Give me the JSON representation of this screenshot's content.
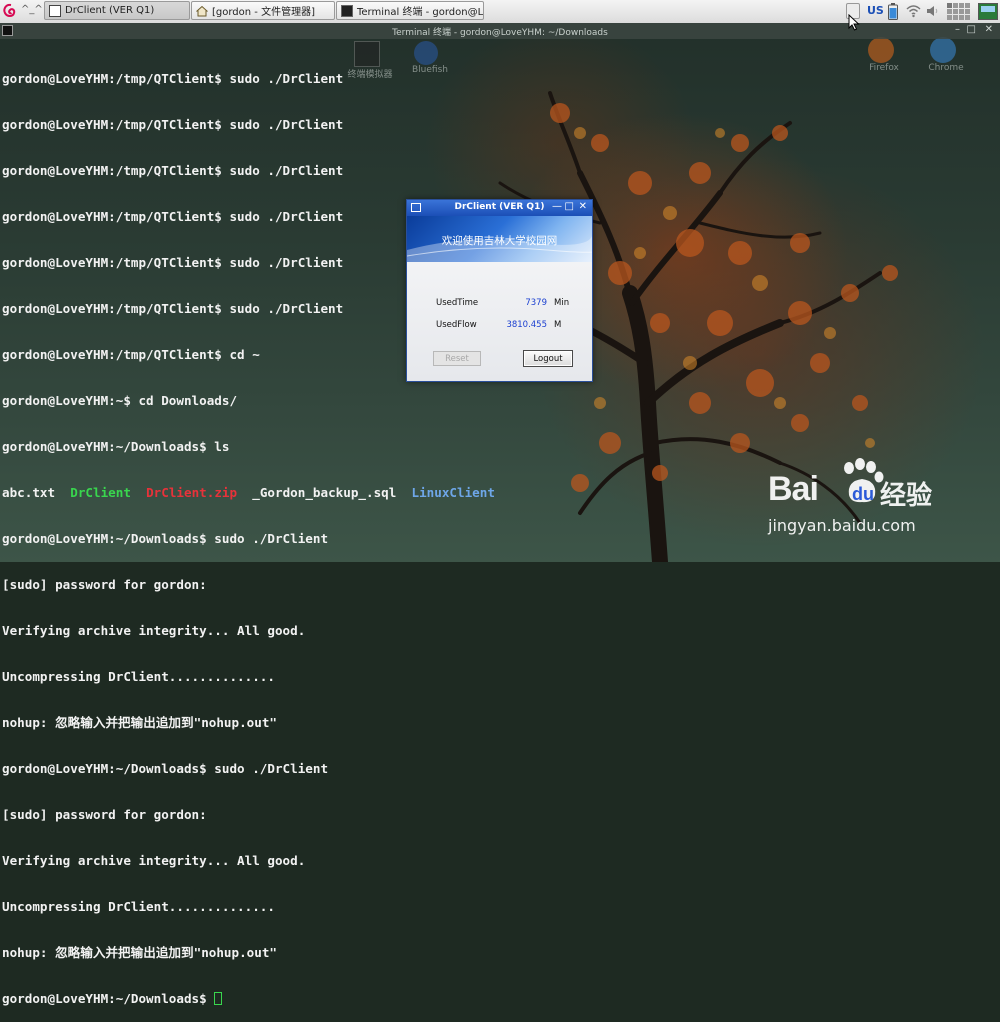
{
  "taskbar": {
    "hat_text": "^_^",
    "tasks": [
      {
        "label": "DrClient (VER Q1)",
        "active": true
      },
      {
        "label": "[gordon - 文件管理器]",
        "active": false
      },
      {
        "label": "Terminal 终端 - gordon@Lo...",
        "active": false
      }
    ],
    "tray": {
      "keyboard_layout": "US"
    }
  },
  "terminal": {
    "window_title": "Terminal 终端 - gordon@LoveYHM: ~/Downloads",
    "lines": [
      "gordon@LoveYHM:/tmp/QTClient$ sudo ./DrClient",
      "gordon@LoveYHM:/tmp/QTClient$ sudo ./DrClient",
      "gordon@LoveYHM:/tmp/QTClient$ sudo ./DrClient",
      "gordon@LoveYHM:/tmp/QTClient$ sudo ./DrClient",
      "gordon@LoveYHM:/tmp/QTClient$ sudo ./DrClient",
      "gordon@LoveYHM:/tmp/QTClient$ sudo ./DrClient",
      "gordon@LoveYHM:/tmp/QTClient$ cd ~",
      "gordon@LoveYHM:~$ cd Downloads/",
      "gordon@LoveYHM:~/Downloads$ ls"
    ],
    "ls_output": {
      "f1": "abc.txt",
      "f2": "DrClient",
      "f3": "DrClient.zip",
      "f4": "_Gordon_backup_.sql",
      "f5": "LinuxClient"
    },
    "lines2": [
      "gordon@LoveYHM:~/Downloads$ sudo ./DrClient",
      "[sudo] password for gordon:",
      "Verifying archive integrity... All good.",
      "Uncompressing DrClient..............",
      "nohup: 忽略输入并把输出追加到\"nohup.out\"",
      "gordon@LoveYHM:~/Downloads$ sudo ./DrClient",
      "[sudo] password for gordon:",
      "Verifying archive integrity... All good.",
      "Uncompressing DrClient..............",
      "nohup: 忽略输入并把输出追加到\"nohup.out\""
    ],
    "prompt": "gordon@LoveYHM:~/Downloads$ "
  },
  "desktop_icons": [
    {
      "label": "终端模拟器"
    },
    {
      "label": "Bluefish"
    },
    {
      "label": "Firefox"
    },
    {
      "label": "Chrome"
    }
  ],
  "dialog": {
    "title": "DrClient (VER Q1)",
    "banner_text": "欢迎使用吉林大学校园网",
    "used_time_label": "UsedTime",
    "used_time_value": "7379",
    "used_time_unit": "Min",
    "used_flow_label": "UsedFlow",
    "used_flow_value": "3810.455",
    "used_flow_unit": "M",
    "reset_label": "Reset",
    "logout_label": "Logout",
    "min_glyph": "—",
    "max_glyph": "□",
    "close_glyph": "✕"
  },
  "watermark": {
    "brand": "Bai",
    "brand2": "du",
    "cn": "经验",
    "url": "jingyan.baidu.com"
  }
}
